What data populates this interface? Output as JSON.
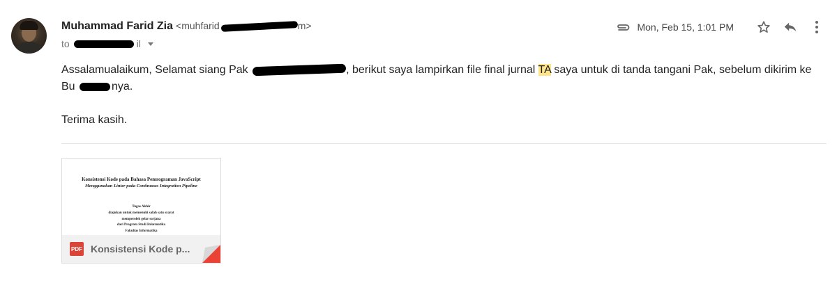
{
  "message": {
    "sender_name": "Muhammad Farid Zia",
    "sender_email": "<muhfarid",
    "sender_email_suffix": "m>",
    "to_label": "to",
    "recipient_visible": "il",
    "date": "Mon, Feb 15, 1:01 PM",
    "body": {
      "p1_a": "Assalamualaikum, Selamat siang Pak ",
      "p1_b": ", berikut saya lampirkan file final jurnal ",
      "p1_highlight": "TA",
      "p1_c": " saya untuk di tanda tangani Pak, sebelum dikirim ke Bu ",
      "p1_d": "nya.",
      "p2": "Terima kasih."
    }
  },
  "icons": {
    "attachment": "paperclip-icon",
    "star": "star-icon",
    "reply": "reply-icon",
    "more": "more-vert-icon",
    "dropdown": "chevron-down-icon",
    "pdf": "pdf-icon"
  },
  "attachment": {
    "type_label": "PDF",
    "name": "Konsistensi Kode p...",
    "preview": {
      "title1": "Konsistensi Kode pada Bahasa Pemrograman JavaScript",
      "title2": "Menggunakan Linter pada Continuous Integration Pipeline",
      "lines": [
        "Tugas Akhir",
        "diajukan untuk memenuhi salah satu syarat",
        "memperoleh gelar sarjana",
        "dari Program Studi Informatika",
        "Fakultas Informatika",
        "Universitas Telkom"
      ]
    }
  },
  "colors": {
    "highlight": "#ffe48a",
    "pdf_red": "#db4437"
  }
}
